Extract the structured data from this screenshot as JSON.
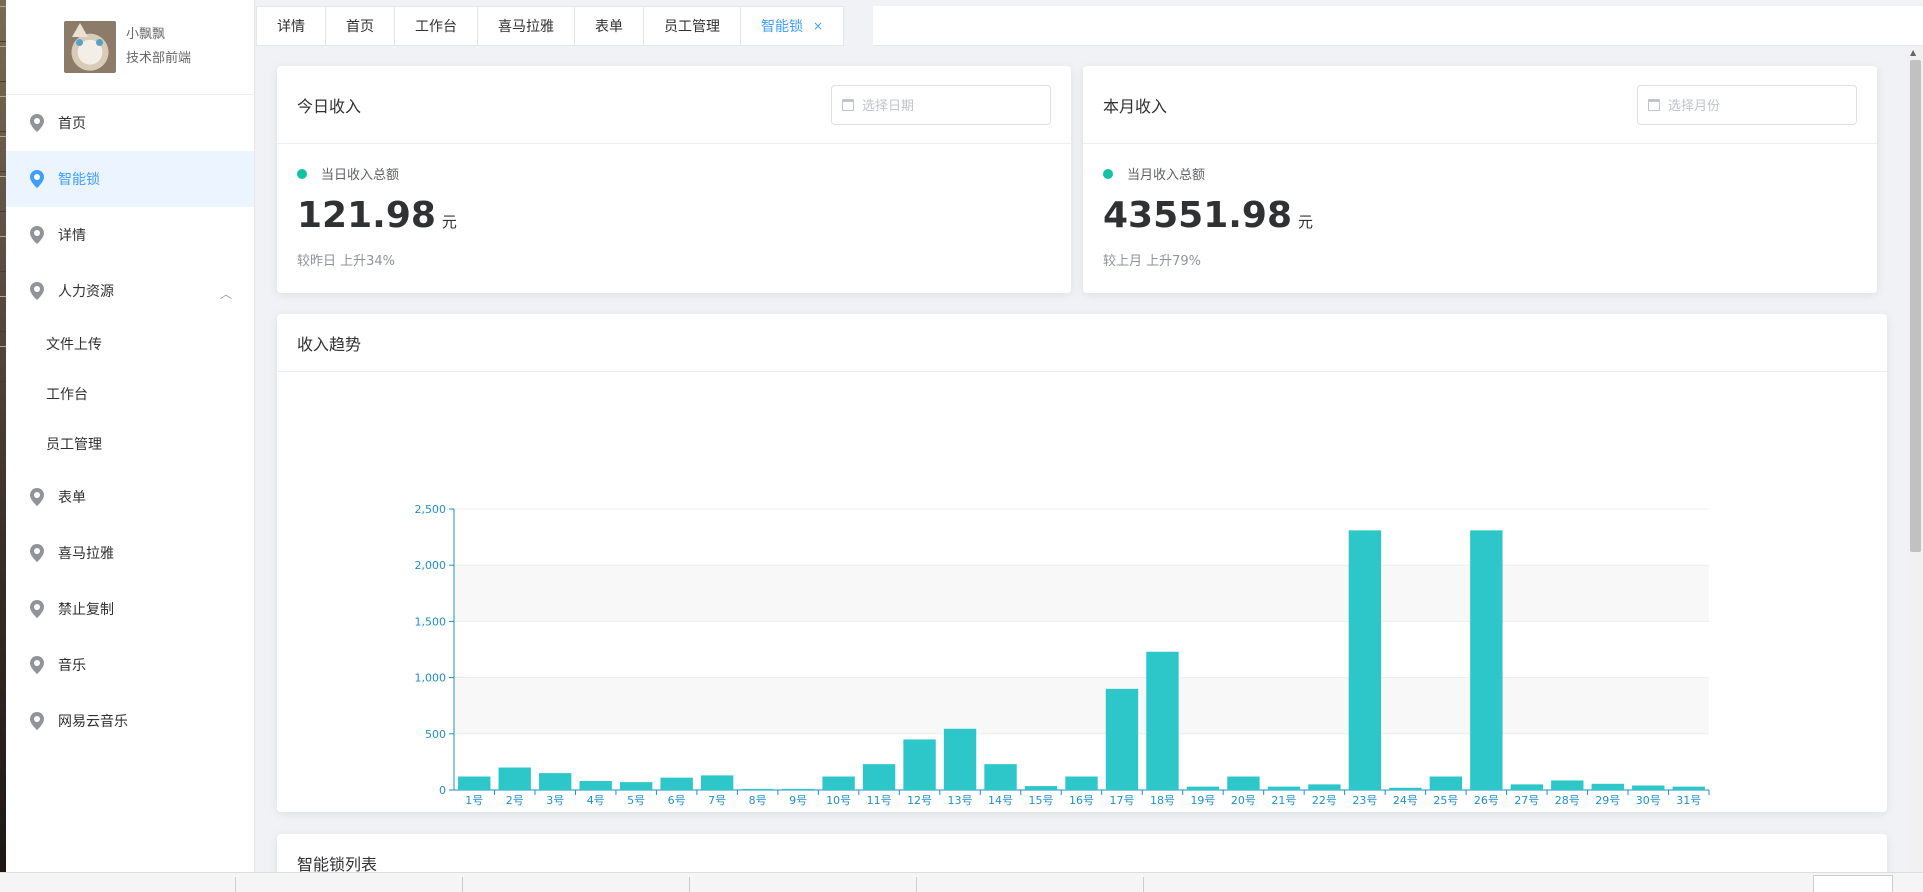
{
  "user": {
    "name": "小飘飘",
    "dept": "技术部前端"
  },
  "sidebar": {
    "items": [
      {
        "label": "首页",
        "active": false
      },
      {
        "label": "智能锁",
        "active": true
      },
      {
        "label": "详情",
        "active": false
      },
      {
        "label": "人力资源",
        "active": false,
        "expanded": true,
        "children": [
          "文件上传",
          "工作台",
          "员工管理"
        ]
      },
      {
        "label": "表单",
        "active": false
      },
      {
        "label": "喜马拉雅",
        "active": false
      },
      {
        "label": "禁止复制",
        "active": false
      },
      {
        "label": "音乐",
        "active": false
      },
      {
        "label": "网易云音乐",
        "active": false
      }
    ]
  },
  "tabs": [
    {
      "label": "详情"
    },
    {
      "label": "首页"
    },
    {
      "label": "工作台"
    },
    {
      "label": "喜马拉雅"
    },
    {
      "label": "表单"
    },
    {
      "label": "员工管理"
    },
    {
      "label": "智能锁",
      "active": true,
      "close": "×"
    }
  ],
  "today": {
    "title": "今日收入",
    "date_placeholder": "选择日期",
    "label": "当日收入总额",
    "value": "121.98",
    "unit": "元",
    "compare": "较昨日 上升34%"
  },
  "month": {
    "title": "本月收入",
    "date_placeholder": "选择月份",
    "label": "当月收入总额",
    "value": "43551.98",
    "unit": "元",
    "compare": "较上月 上升79%"
  },
  "trend": {
    "title": "收入趋势"
  },
  "list": {
    "title": "智能锁列表"
  },
  "colors": {
    "accent": "#409eff",
    "bar": "#2ec7c9",
    "dot": "#13c2a3",
    "axis": "#1e90c8"
  },
  "chart_data": {
    "type": "bar",
    "categories": [
      "1号",
      "2号",
      "3号",
      "4号",
      "5号",
      "6号",
      "7号",
      "8号",
      "9号",
      "10号",
      "11号",
      "12号",
      "13号",
      "14号",
      "15号",
      "16号",
      "17号",
      "18号",
      "19号",
      "20号",
      "21号",
      "22号",
      "23号",
      "24号",
      "25号",
      "26号",
      "27号",
      "28号",
      "29号",
      "30号",
      "31号"
    ],
    "values": [
      120,
      200,
      150,
      80,
      70,
      110,
      130,
      10,
      10,
      120,
      230,
      450,
      545,
      230,
      35,
      120,
      900,
      1230,
      30,
      120,
      30,
      50,
      2310,
      20,
      120,
      2310,
      50,
      85,
      55,
      40,
      30
    ],
    "yticks": [
      "0",
      "500",
      "1,000",
      "1,500",
      "2,000",
      "2,500"
    ],
    "ylim": [
      0,
      2500
    ],
    "grid": true,
    "xlabel": "",
    "ylabel": ""
  }
}
